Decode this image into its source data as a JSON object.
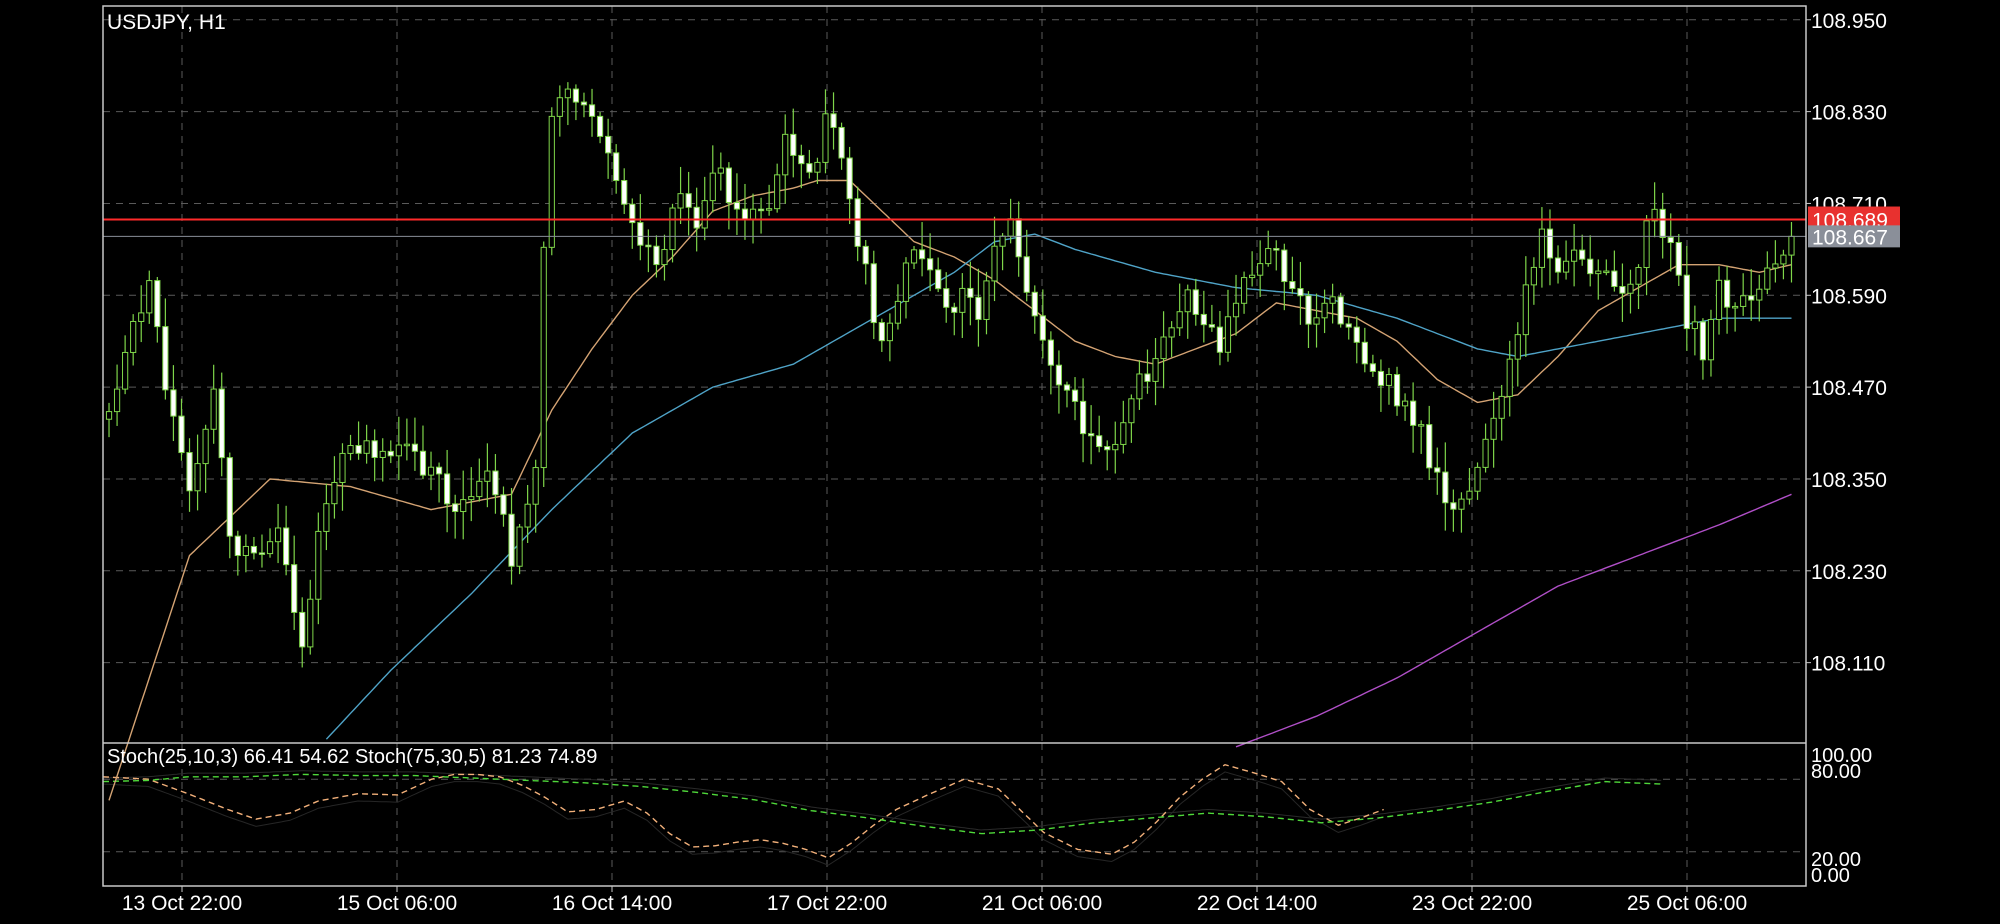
{
  "symbol_label": "USDJPY, H1",
  "indicator_label": "Stoch(25,10,3) 66.41 54.62 Stoch(75,30,5) 81.23 74.89",
  "colors": {
    "background": "#000000",
    "frame": "#c8c8c8",
    "grid": "#5a5a5a",
    "candle": "#7fd64a",
    "candle_body_up": "#000000",
    "candle_body_down": "#ffffff",
    "ma_fast": "#d4a373",
    "ma_mid": "#4fa3c7",
    "ma_slow": "#b04fc7",
    "bid_line": "#ff2a2a",
    "bid_tag": "#e8312f",
    "ask_line": "#8a8f99",
    "ask_tag": "#8a8f99",
    "stoch_fast": "#f2b07a",
    "stoch_slow": "#4fd83a"
  },
  "chart_data": [
    {
      "type": "candlestick",
      "title": "USDJPY, H1",
      "x_tick_labels": [
        "13 Oct 22:00",
        "15 Oct 06:00",
        "16 Oct 14:00",
        "17 Oct 22:00",
        "21 Oct 06:00",
        "22 Oct 14:00",
        "23 Oct 22:00",
        "25 Oct 06:00"
      ],
      "y_tick_labels": [
        "108.950",
        "108.830",
        "108.710",
        "108.590",
        "108.470",
        "108.350",
        "108.230",
        "108.110"
      ],
      "ylim": [
        108.005,
        108.968
      ],
      "grid": true,
      "bid": "108.689",
      "ask": "108.667",
      "close_path": [
        [
          0,
          108.45
        ],
        [
          3,
          108.54
        ],
        [
          5,
          108.6
        ],
        [
          8,
          108.42
        ],
        [
          10,
          108.33
        ],
        [
          13,
          108.47
        ],
        [
          15,
          108.28
        ],
        [
          18,
          108.24
        ],
        [
          21,
          108.3
        ],
        [
          23,
          108.17
        ],
        [
          24,
          108.12
        ],
        [
          26,
          108.28
        ],
        [
          28,
          108.36
        ],
        [
          31,
          108.4
        ],
        [
          34,
          108.38
        ],
        [
          38,
          108.38
        ],
        [
          41,
          108.34
        ],
        [
          44,
          108.31
        ],
        [
          47,
          108.36
        ],
        [
          49,
          108.32
        ],
        [
          50,
          108.22
        ],
        [
          52,
          108.32
        ],
        [
          53,
          108.36
        ],
        [
          54,
          108.66
        ],
        [
          55,
          108.82
        ],
        [
          57,
          108.86
        ],
        [
          60,
          108.84
        ],
        [
          62,
          108.79
        ],
        [
          64,
          108.7
        ],
        [
          66,
          108.66
        ],
        [
          68,
          108.64
        ],
        [
          71,
          108.72
        ],
        [
          73,
          108.68
        ],
        [
          75,
          108.76
        ],
        [
          77,
          108.72
        ],
        [
          80,
          108.7
        ],
        [
          82,
          108.72
        ],
        [
          84,
          108.8
        ],
        [
          87,
          108.74
        ],
        [
          89,
          108.82
        ],
        [
          91,
          108.78
        ],
        [
          92,
          108.72
        ],
        [
          94,
          108.62
        ],
        [
          96,
          108.52
        ],
        [
          98,
          108.58
        ],
        [
          100,
          108.66
        ],
        [
          102,
          108.62
        ],
        [
          104,
          108.56
        ],
        [
          106,
          108.6
        ],
        [
          108,
          108.56
        ],
        [
          110,
          108.64
        ],
        [
          112,
          108.68
        ],
        [
          114,
          108.6
        ],
        [
          116,
          108.54
        ],
        [
          118,
          108.48
        ],
        [
          120,
          108.44
        ],
        [
          122,
          108.4
        ],
        [
          124,
          108.38
        ],
        [
          126,
          108.42
        ],
        [
          128,
          108.48
        ],
        [
          130,
          108.5
        ],
        [
          132,
          108.55
        ],
        [
          134,
          108.6
        ],
        [
          136,
          108.56
        ],
        [
          138,
          108.52
        ],
        [
          140,
          108.58
        ],
        [
          142,
          108.62
        ],
        [
          144,
          108.66
        ],
        [
          146,
          108.62
        ],
        [
          148,
          108.58
        ],
        [
          150,
          108.55
        ],
        [
          152,
          108.58
        ],
        [
          154,
          108.54
        ],
        [
          156,
          108.5
        ],
        [
          158,
          108.48
        ],
        [
          160,
          108.46
        ],
        [
          162,
          108.43
        ],
        [
          164,
          108.38
        ],
        [
          166,
          108.32
        ],
        [
          168,
          108.32
        ],
        [
          170,
          108.38
        ],
        [
          172,
          108.42
        ],
        [
          174,
          108.5
        ],
        [
          176,
          108.6
        ],
        [
          178,
          108.66
        ],
        [
          180,
          108.63
        ],
        [
          182,
          108.64
        ],
        [
          184,
          108.62
        ],
        [
          186,
          108.61
        ],
        [
          188,
          108.6
        ],
        [
          190,
          108.64
        ],
        [
          192,
          108.7
        ],
        [
          194,
          108.66
        ],
        [
          196,
          108.56
        ],
        [
          198,
          108.52
        ],
        [
          200,
          108.6
        ],
        [
          202,
          108.56
        ],
        [
          204,
          108.6
        ],
        [
          206,
          108.62
        ],
        [
          208,
          108.64
        ],
        [
          209,
          108.667
        ]
      ],
      "series": [
        {
          "values": [
            [
              0,
              107.93
            ],
            [
              10,
              108.25
            ],
            [
              20,
              108.35
            ],
            [
              30,
              108.34
            ],
            [
              40,
              108.31
            ],
            [
              50,
              108.33
            ],
            [
              55,
              108.44
            ],
            [
              60,
              108.52
            ],
            [
              65,
              108.59
            ],
            [
              70,
              108.64
            ],
            [
              75,
              108.7
            ],
            [
              80,
              108.72
            ],
            [
              85,
              108.73
            ],
            [
              88,
              108.74
            ],
            [
              92,
              108.74
            ],
            [
              96,
              108.7
            ],
            [
              100,
              108.66
            ],
            [
              105,
              108.64
            ],
            [
              110,
              108.61
            ],
            [
              115,
              108.57
            ],
            [
              120,
              108.53
            ],
            [
              125,
              108.51
            ],
            [
              130,
              108.5
            ],
            [
              135,
              108.52
            ],
            [
              140,
              108.54
            ],
            [
              145,
              108.58
            ],
            [
              150,
              108.57
            ],
            [
              155,
              108.56
            ],
            [
              160,
              108.53
            ],
            [
              165,
              108.48
            ],
            [
              170,
              108.45
            ],
            [
              175,
              108.46
            ],
            [
              180,
              108.51
            ],
            [
              185,
              108.57
            ],
            [
              190,
              108.6
            ],
            [
              195,
              108.63
            ],
            [
              200,
              108.63
            ],
            [
              205,
              108.62
            ],
            [
              209,
              108.63
            ]
          ]
        },
        {
          "values": [
            [
              27,
              108.01
            ],
            [
              35,
              108.1
            ],
            [
              45,
              108.2
            ],
            [
              55,
              108.31
            ],
            [
              65,
              108.41
            ],
            [
              75,
              108.47
            ],
            [
              85,
              108.5
            ],
            [
              95,
              108.56
            ],
            [
              105,
              108.62
            ],
            [
              110,
              108.66
            ],
            [
              115,
              108.67
            ],
            [
              120,
              108.65
            ],
            [
              130,
              108.62
            ],
            [
              140,
              108.6
            ],
            [
              150,
              108.59
            ],
            [
              160,
              108.56
            ],
            [
              170,
              108.52
            ],
            [
              175,
              108.51
            ],
            [
              180,
              108.52
            ],
            [
              190,
              108.54
            ],
            [
              200,
              108.56
            ],
            [
              209,
              108.56
            ]
          ]
        },
        {
          "values": [
            [
              140,
              108.0
            ],
            [
              150,
              108.04
            ],
            [
              160,
              108.09
            ],
            [
              170,
              108.15
            ],
            [
              180,
              108.21
            ],
            [
              190,
              108.25
            ],
            [
              200,
              108.29
            ],
            [
              209,
              108.33
            ]
          ]
        }
      ]
    },
    {
      "type": "line",
      "title": "Stoch(25,10,3) 66.41 54.62 Stoch(75,30,5) 81.23 74.89",
      "y_tick_labels": [
        "100.00",
        "80.00",
        "20.00",
        "0.00"
      ],
      "ylim": [
        0,
        100
      ],
      "levels": [
        20,
        80
      ],
      "grid": true,
      "series": [
        {
          "name": "Stoch(25,10,3)",
          "values": [
            [
              0,
              82
            ],
            [
              8,
              80
            ],
            [
              15,
              68
            ],
            [
              22,
              55
            ],
            [
              27,
              47
            ],
            [
              33,
              52
            ],
            [
              38,
              62
            ],
            [
              45,
              68
            ],
            [
              52,
              67
            ],
            [
              58,
              80
            ],
            [
              62,
              84
            ],
            [
              66,
              84
            ],
            [
              70,
              82
            ],
            [
              74,
              75
            ],
            [
              78,
              65
            ],
            [
              82,
              53
            ],
            [
              87,
              55
            ],
            [
              92,
              62
            ],
            [
              96,
              52
            ],
            [
              100,
              35
            ],
            [
              104,
              24
            ],
            [
              108,
              25
            ],
            [
              112,
              28
            ],
            [
              116,
              30
            ],
            [
              120,
              27
            ],
            [
              124,
              22
            ],
            [
              128,
              15
            ],
            [
              132,
              27
            ],
            [
              136,
              42
            ],
            [
              140,
              55
            ],
            [
              146,
              68
            ],
            [
              152,
              80
            ],
            [
              158,
              72
            ],
            [
              162,
              54
            ],
            [
              166,
              36
            ],
            [
              172,
              22
            ],
            [
              178,
              18
            ],
            [
              182,
              28
            ],
            [
              186,
              45
            ],
            [
              190,
              65
            ],
            [
              194,
              80
            ],
            [
              198,
              92
            ],
            [
              204,
              84
            ],
            [
              208,
              78
            ],
            [
              213,
              55
            ],
            [
              218,
              42
            ],
            [
              222,
              48
            ],
            [
              226,
              55
            ]
          ]
        },
        {
          "name": "Stoch(75,30,5)",
          "values": [
            [
              0,
              78
            ],
            [
              8,
              79
            ],
            [
              15,
              82
            ],
            [
              25,
              82
            ],
            [
              35,
              84
            ],
            [
              45,
              83
            ],
            [
              55,
              83
            ],
            [
              65,
              81
            ],
            [
              75,
              79
            ],
            [
              85,
              77
            ],
            [
              95,
              74
            ],
            [
              105,
              69
            ],
            [
              115,
              63
            ],
            [
              125,
              54
            ],
            [
              135,
              48
            ],
            [
              145,
              41
            ],
            [
              155,
              35
            ],
            [
              165,
              38
            ],
            [
              175,
              44
            ],
            [
              185,
              48
            ],
            [
              195,
              52
            ],
            [
              205,
              49
            ],
            [
              215,
              44
            ],
            [
              225,
              48
            ],
            [
              235,
              54
            ],
            [
              245,
              61
            ],
            [
              255,
              70
            ],
            [
              265,
              78
            ],
            [
              275,
              76
            ]
          ]
        }
      ]
    }
  ]
}
